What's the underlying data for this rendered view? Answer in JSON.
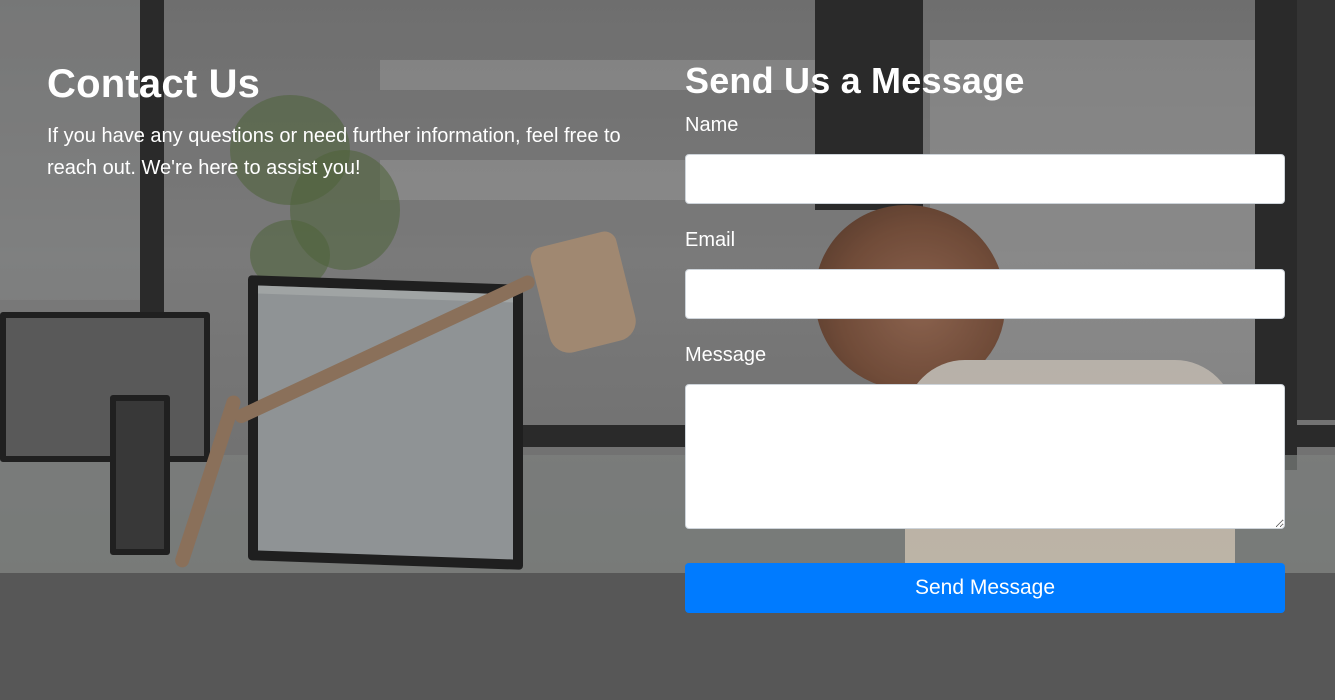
{
  "contact": {
    "title": "Contact Us",
    "description": "If you have any questions or need further information, feel free to reach out. We're here to assist you!"
  },
  "form": {
    "title": "Send Us a Message",
    "name_label": "Name",
    "name_value": "",
    "email_label": "Email",
    "email_value": "",
    "message_label": "Message",
    "message_value": "",
    "submit_label": "Send Message"
  },
  "colors": {
    "accent": "#007bff",
    "page_background": "#575757",
    "text": "#ffffff"
  },
  "background_image": {
    "subject": "office-workspace-photo"
  }
}
